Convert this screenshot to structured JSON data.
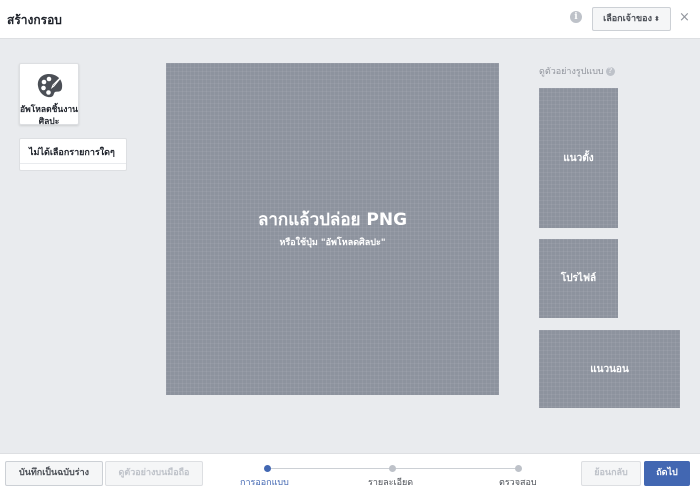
{
  "header": {
    "title": "สร้างกรอบ",
    "page_select_label": "เลือกเจ้าของ",
    "close_glyph": "×"
  },
  "sidebar": {
    "upload_label": "อัพโหลดชิ้นงานศิลปะ",
    "select_label": "ไม่ได้เลือกรายการใดๆ"
  },
  "canvas": {
    "main_text": "ลากแล้วปล่อย PNG",
    "sub_text": "หรือใช้ปุ่ม \"อัพโหลดศิลปะ\""
  },
  "preview": {
    "label": "ดูตัวอย่างรูปแบบ",
    "portrait": "แนวตั้ง",
    "profile": "โปรไฟล์",
    "landscape": "แนวนอน"
  },
  "footer": {
    "save_draft": "บันทึกเป็นฉบับร่าง",
    "mobile_preview": "ดูตัวอย่างบนมือถือ",
    "steps": [
      "การออกแบบ",
      "รายละเอียด",
      "ตรวจสอบ"
    ],
    "active_step": 1,
    "back": "ย้อนกลับ",
    "next": "ถัดไป"
  },
  "colors": {
    "accent": "#4267b2",
    "placeholder": "#8d939e",
    "background": "#e9ebee"
  },
  "icons": [
    "info-icon",
    "caret-icon",
    "close-icon",
    "palette-icon",
    "question-icon"
  ]
}
